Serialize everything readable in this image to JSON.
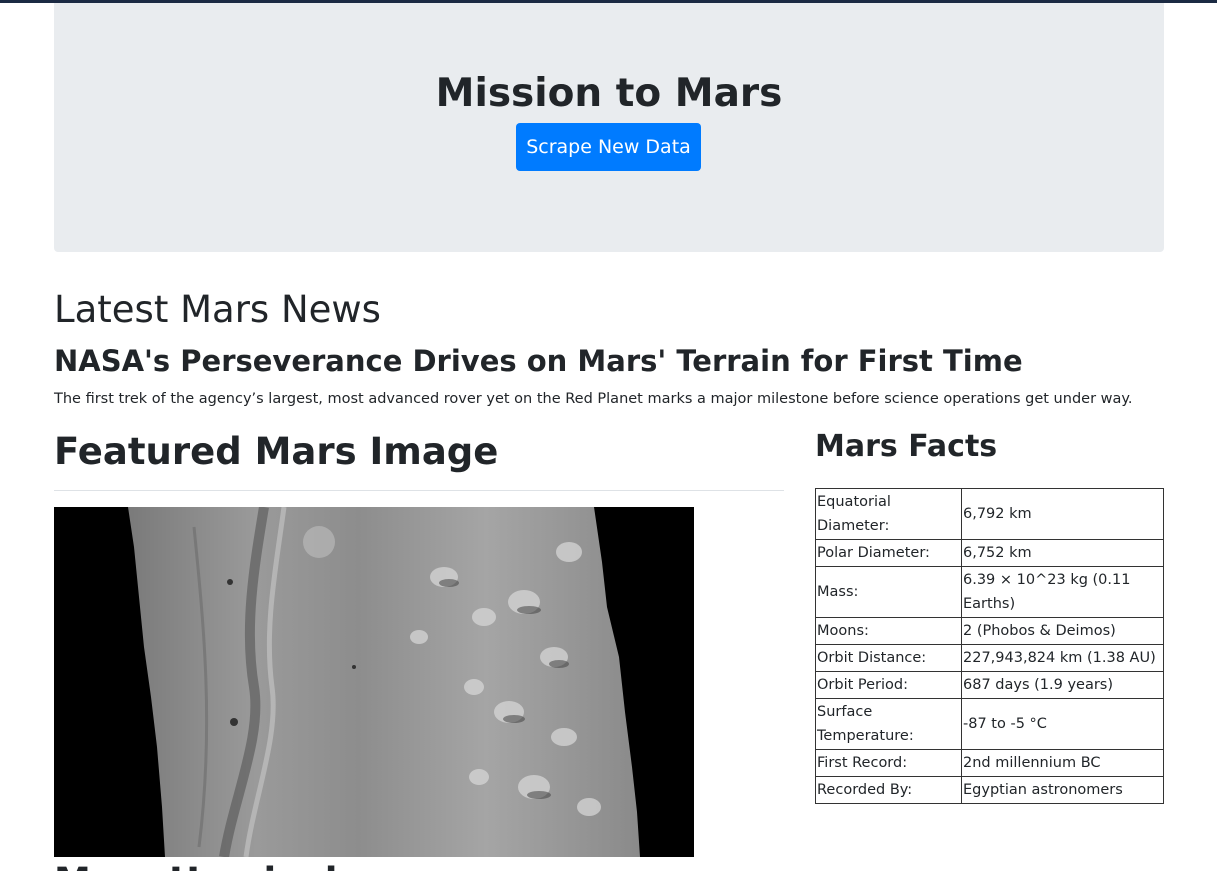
{
  "header": {
    "title": "Mission to Mars",
    "scrape_button_label": "Scrape New Data"
  },
  "news": {
    "section_heading": "Latest Mars News",
    "title": "NASA's Perseverance Drives on Mars' Terrain for First Time",
    "paragraph": "The first trek of the agency’s largest, most advanced rover yet on the Red Planet marks a major milestone before science operations get under way."
  },
  "featured": {
    "heading": "Featured Mars Image"
  },
  "hemispheres": {
    "heading": "Mars Hemispheres"
  },
  "facts": {
    "heading": "Mars Facts",
    "rows": [
      {
        "label": "Equatorial Diameter:",
        "value": "6,792 km"
      },
      {
        "label": "Polar Diameter:",
        "value": "6,752 km"
      },
      {
        "label": "Mass:",
        "value": "6.39 × 10^23 kg (0.11 Earths)"
      },
      {
        "label": "Moons:",
        "value": "2 (Phobos & Deimos)"
      },
      {
        "label": "Orbit Distance:",
        "value": "227,943,824 km (1.38 AU)"
      },
      {
        "label": "Orbit Period:",
        "value": "687 days (1.9 years)"
      },
      {
        "label": "Surface Temperature:",
        "value": "-87 to -5 °C"
      },
      {
        "label": "First Record:",
        "value": "2nd millennium BC"
      },
      {
        "label": "Recorded By:",
        "value": "Egyptian astronomers"
      }
    ]
  },
  "colors": {
    "primary_button": "#007bff",
    "jumbotron_bg": "#e9ecef",
    "topbar": "#1b2a43"
  }
}
